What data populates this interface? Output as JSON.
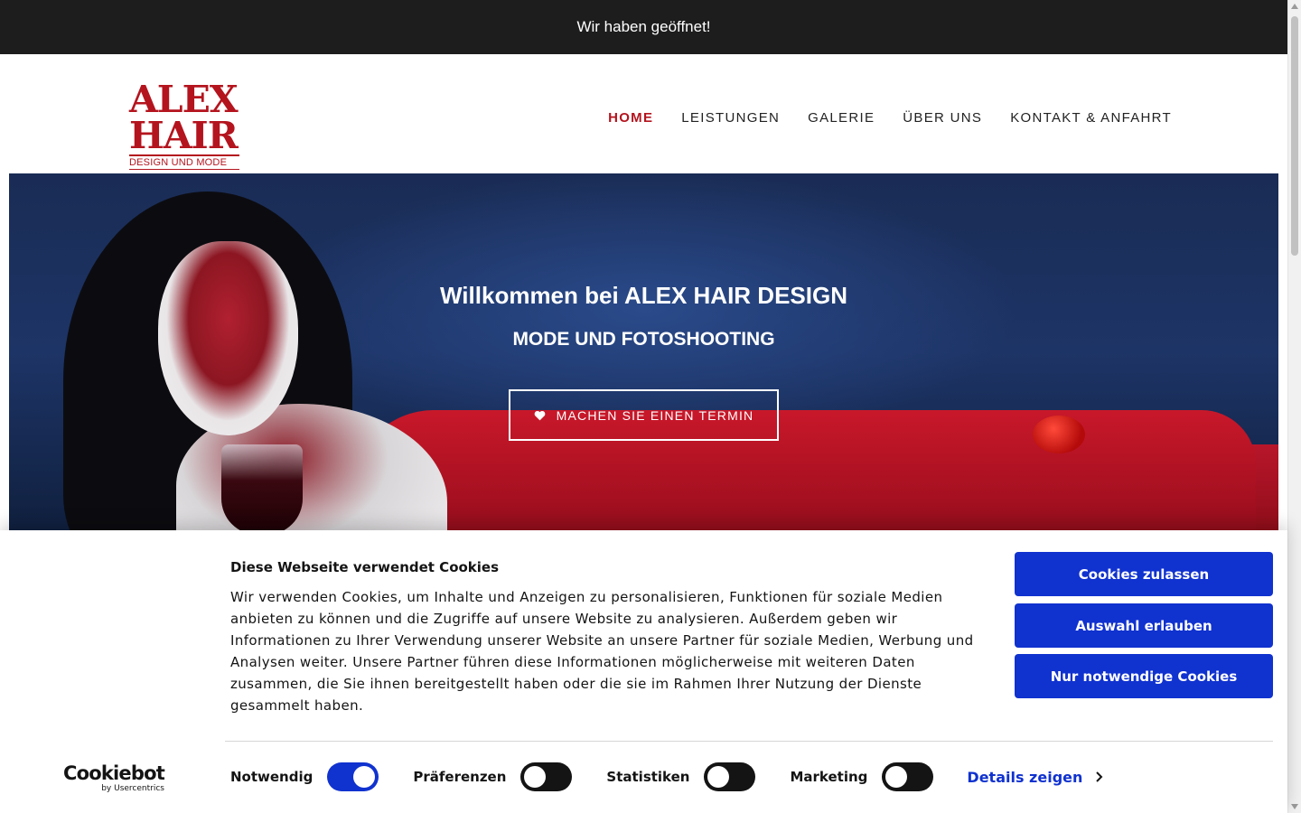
{
  "topbar": {
    "text": "Wir haben geöffnet!"
  },
  "logo": {
    "line1": "ALEX",
    "line2": "HAIR",
    "line3": "DESIGN UND MODE"
  },
  "nav": {
    "items": [
      "HOME",
      "LEISTUNGEN",
      "GALERIE",
      "ÜBER UNS",
      "KONTAKT & ANFAHRT"
    ],
    "active": "HOME"
  },
  "hero": {
    "title": "Willkommen bei ALEX HAIR DESIGN",
    "subtitle": "MODE UND FOTOSHOOTING",
    "cta_label": "MACHEN SIE EINEN TERMIN",
    "cta_icon": "heart-icon"
  },
  "cookie": {
    "title": "Diese Webseite verwendet Cookies",
    "text": "Wir verwenden Cookies, um Inhalte und Anzeigen zu personalisieren, Funktionen für soziale Medien anbieten zu können und die Zugriffe auf unsere Website zu analysieren. Außerdem geben wir Informationen zu Ihrer Verwendung unserer Website an unsere Partner für soziale Medien, Werbung und Analysen weiter. Unsere Partner führen diese Informationen möglicherweise mit weiteren Daten zusammen, die Sie ihnen bereitgestellt haben oder die sie im Rahmen Ihrer Nutzung der Dienste gesammelt haben.",
    "buttons": {
      "allow_all": "Cookies zulassen",
      "allow_selection": "Auswahl erlauben",
      "necessary_only": "Nur notwendige Cookies"
    },
    "brand": {
      "name": "Cookiebot",
      "byline": "by Usercentrics"
    },
    "toggles": [
      {
        "label": "Notwendig",
        "on": true
      },
      {
        "label": "Präferenzen",
        "on": false
      },
      {
        "label": "Statistiken",
        "on": false
      },
      {
        "label": "Marketing",
        "on": false
      }
    ],
    "details_label": "Details zeigen"
  },
  "colors": {
    "accent_red": "#b4141e",
    "cookie_blue": "#1032cf",
    "topbar_bg": "#1d1d1d"
  }
}
